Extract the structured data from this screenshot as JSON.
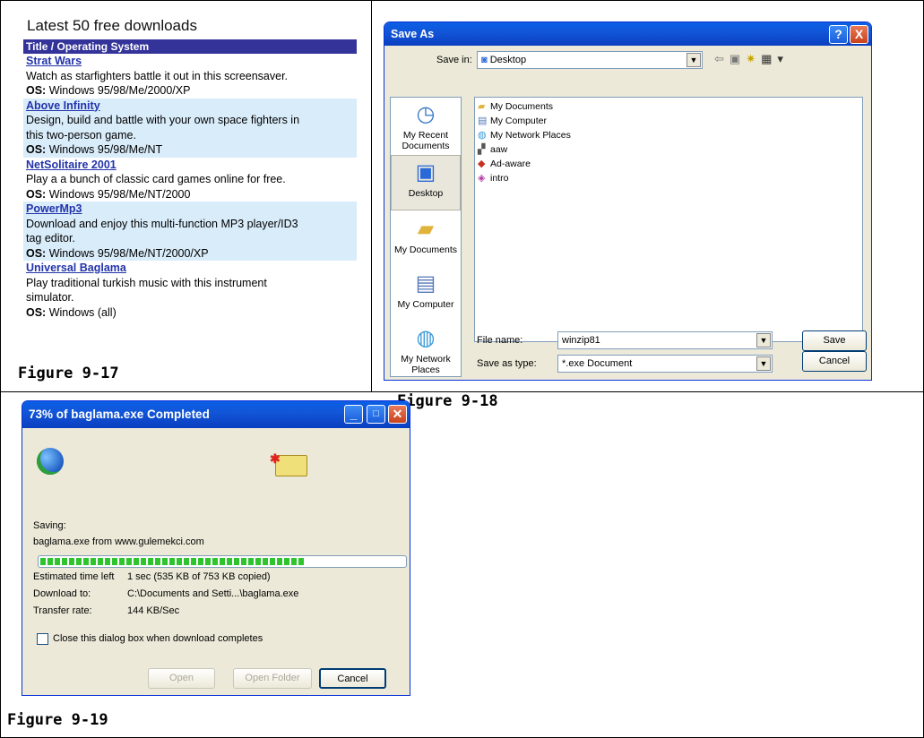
{
  "downloads_panel": {
    "heading": "Latest 50 free downloads",
    "column_header": "Title / Operating System",
    "os_label": "OS:",
    "items": [
      {
        "title": "Strat Wars",
        "desc_lines": [
          "Watch as starfighters battle it out in this screensaver."
        ],
        "os": "Windows 95/98/Me/2000/XP"
      },
      {
        "title": "Above Infinity",
        "desc_lines": [
          "Design, build and battle with your own space fighters in",
          "this two-person game."
        ],
        "os": "Windows 95/98/Me/NT"
      },
      {
        "title": "NetSolitaire 2001",
        "desc_lines": [
          "Play a a bunch of classic card games online for free."
        ],
        "os": "Windows 95/98/Me/NT/2000"
      },
      {
        "title": "PowerMp3",
        "desc_lines": [
          "Download and enjoy this multi-function MP3 player/ID3",
          "tag editor."
        ],
        "os": "Windows 95/98/Me/NT/2000/XP"
      },
      {
        "title": "Universal Baglama",
        "desc_lines": [
          "Play traditional turkish music with this instrument",
          "simulator."
        ],
        "os": "Windows (all)"
      }
    ]
  },
  "captions": {
    "fig17": "Figure 9-17",
    "fig18": "Figure 9-18",
    "fig19": "Figure 9-19"
  },
  "save_as": {
    "title": "Save As",
    "help_btn": "?",
    "close_btn": "X",
    "save_in_label": "Save in:",
    "save_in_value": "Desktop",
    "places": [
      {
        "label_lines": [
          "My Recent",
          "Documents"
        ],
        "icon": "recent-documents-icon"
      },
      {
        "label_lines": [
          "Desktop"
        ],
        "icon": "desktop-icon"
      },
      {
        "label_lines": [
          "My Documents"
        ],
        "icon": "my-documents-icon"
      },
      {
        "label_lines": [
          "My Computer"
        ],
        "icon": "my-computer-icon"
      },
      {
        "label_lines": [
          "My Network",
          "Places"
        ],
        "icon": "network-places-icon"
      }
    ],
    "files": [
      {
        "name": "My Documents",
        "icon": "folder-icon"
      },
      {
        "name": "My Computer",
        "icon": "computer-icon"
      },
      {
        "name": "My Network Places",
        "icon": "network-icon"
      },
      {
        "name": "aaw",
        "icon": "app-icon"
      },
      {
        "name": "Ad-aware",
        "icon": "adaware-icon"
      },
      {
        "name": "intro",
        "icon": "media-icon"
      }
    ],
    "file_name_label": "File name:",
    "file_name_value": "winzip81",
    "save_type_label": "Save as type:",
    "save_type_value": "*.exe Document",
    "save_button": "Save",
    "cancel_button": "Cancel"
  },
  "download": {
    "title": "73% of baglama.exe Completed",
    "progress_fraction": 0.73,
    "saving_label": "Saving:",
    "saving_value": "baglama.exe from www.gulemekci.com",
    "time_left_label": "Estimated time left",
    "time_left_value": "1 sec (535 KB of 753 KB copied)",
    "download_to_label": "Download to:",
    "download_to_value": "C:\\Documents and Setti...\\baglama.exe",
    "rate_label": "Transfer rate:",
    "rate_value": "144 KB/Sec",
    "close_checkbox_label": "Close this dialog box when download completes",
    "open_button": "Open",
    "open_folder_button": "Open Folder",
    "cancel_button": "Cancel"
  }
}
